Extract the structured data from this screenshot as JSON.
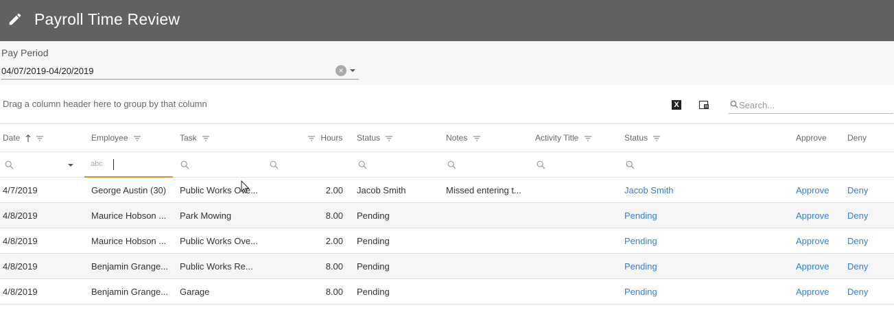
{
  "header": {
    "title": "Payroll Time Review",
    "icon": "pencil-icon"
  },
  "pay_period": {
    "label": "Pay Period",
    "value": "04/07/2019-04/20/2019"
  },
  "toolbar": {
    "group_hint": "Drag a column header here to group by that column",
    "export_icon": "excel-export-icon",
    "column_chooser_icon": "column-chooser-icon",
    "search_placeholder": "Search..."
  },
  "columns": {
    "date": "Date",
    "employee": "Employee",
    "task": "Task",
    "hours": "Hours",
    "status": "Status",
    "notes": "Notes",
    "activity_title": "Activity Title",
    "status2": "Status",
    "approve": "Approve",
    "deny": "Deny"
  },
  "filter": {
    "text_placeholder": "abc"
  },
  "rows": [
    {
      "date": "4/7/2019",
      "employee": "George Austin (30)",
      "task": "Public Works Ove...",
      "hours": "2.00",
      "status": "Jacob Smith",
      "notes": "Missed entering t...",
      "activity_title": "",
      "status_link": "Jacob Smith",
      "approve": "Approve",
      "deny": "Deny"
    },
    {
      "date": "4/8/2019",
      "employee": "Maurice Hobson ...",
      "task": "Park Mowing",
      "hours": "8.00",
      "status": "Pending",
      "notes": "",
      "activity_title": "",
      "status_link": "Pending",
      "approve": "Approve",
      "deny": "Deny"
    },
    {
      "date": "4/8/2019",
      "employee": "Maurice Hobson ...",
      "task": "Public Works Ove...",
      "hours": "2.00",
      "status": "Pending",
      "notes": "",
      "activity_title": "",
      "status_link": "Pending",
      "approve": "Approve",
      "deny": "Deny"
    },
    {
      "date": "4/8/2019",
      "employee": "Benjamin Grange...",
      "task": "Public Works Re...",
      "hours": "8.00",
      "status": "Pending",
      "notes": "",
      "activity_title": "",
      "status_link": "Pending",
      "approve": "Approve",
      "deny": "Deny"
    },
    {
      "date": "4/8/2019",
      "employee": "Benjamin Grange...",
      "task": "Garage",
      "hours": "8.00",
      "status": "Pending",
      "notes": "",
      "activity_title": "",
      "status_link": "Pending",
      "approve": "Approve",
      "deny": "Deny"
    }
  ],
  "colors": {
    "header_bg": "#616161",
    "link": "#2f80d6",
    "filter_focus": "#e08a3a"
  }
}
